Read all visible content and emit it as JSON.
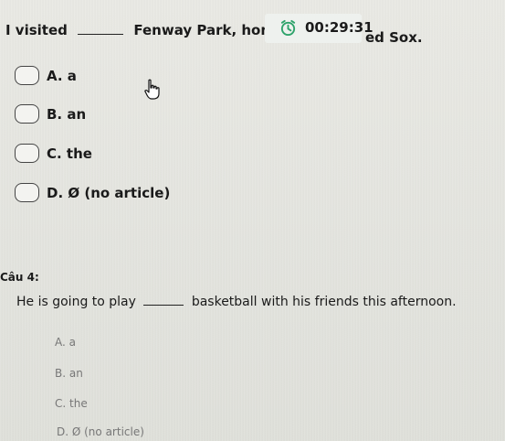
{
  "question1": {
    "text_before": "I visited",
    "text_after": "Fenway Park, home of",
    "text_tail": "ed Sox.",
    "options": [
      "A. a",
      "B. an",
      "C. the",
      "D. Ø (no article)"
    ]
  },
  "timer": {
    "value": "00:29:31",
    "icon": "alarm-clock-icon"
  },
  "question2": {
    "label": "Câu 4:",
    "text_before": "He is going to play",
    "text_after": "basketball with his friends this afternoon.",
    "options": [
      "A. a",
      "B. an",
      "C. the",
      "D. Ø (no article)"
    ]
  },
  "colors": {
    "background": "#e6e6e1",
    "timer_accent": "#2fa36b"
  }
}
